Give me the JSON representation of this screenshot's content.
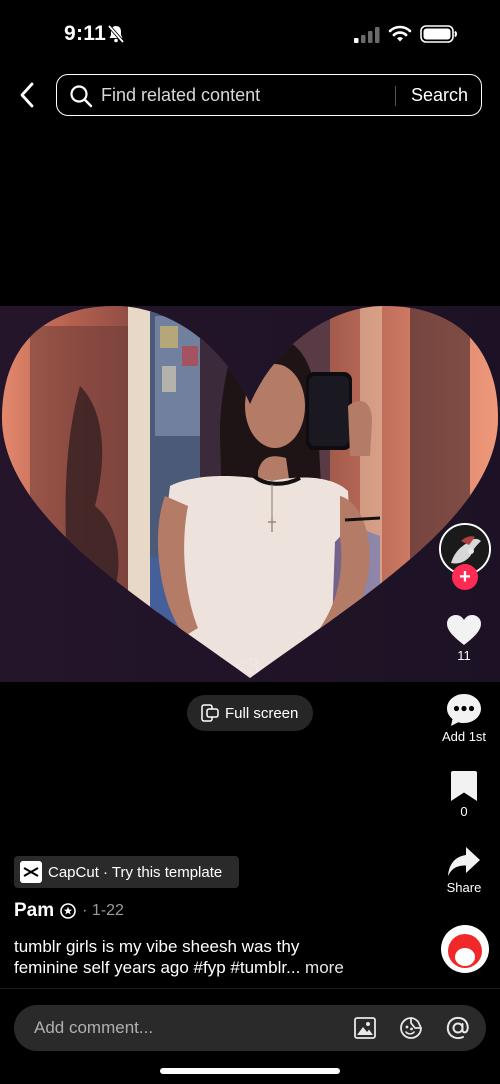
{
  "status_bar": {
    "time": "9:11"
  },
  "search": {
    "placeholder": "Find related content",
    "button_label": "Search"
  },
  "video": {
    "overlay_text": "<3"
  },
  "fullscreen_label": "Full screen",
  "rail": {
    "like_count": "11",
    "comment_label": "Add 1st",
    "favorite_count": "0",
    "share_label": "Share"
  },
  "post": {
    "template_label": "CapCut · Try this template",
    "author": "Pam",
    "date": "· 1-22",
    "description_line1": "tumblr girls is my vibe   sheesh was thy",
    "description_line2": "feminine self years ago  #fyp #tumblr...",
    "more_label": "more"
  },
  "comment_input": {
    "placeholder": "Add comment..."
  },
  "colors": {
    "accent": "#fe2c55",
    "background": "#000000",
    "input_bg": "#2a2a2a"
  }
}
